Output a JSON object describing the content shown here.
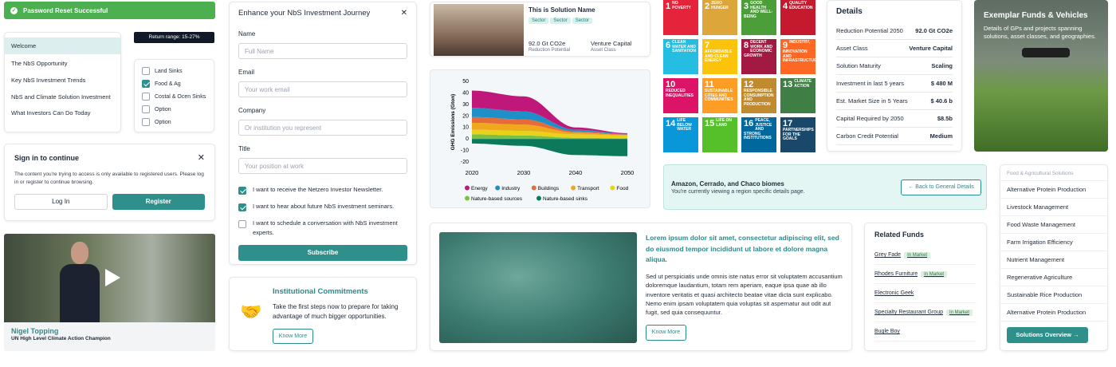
{
  "toast": {
    "text": "Password Reset Successful"
  },
  "nav": {
    "items": [
      "Welcome",
      "The NbS Opportunity",
      "Key NbS Investment Trends",
      "NbS and Climate Solution Investment",
      "What Investors Can Do Today"
    ]
  },
  "filter": {
    "tooltip": "Return range: 15-27%",
    "options": [
      {
        "label": "Land Sinks",
        "checked": false
      },
      {
        "label": "Food & Ag",
        "checked": true
      },
      {
        "label": "Costal & Ocen Sinks",
        "checked": false
      },
      {
        "label": "Option",
        "checked": false
      },
      {
        "label": "Option",
        "checked": false
      }
    ]
  },
  "signin": {
    "title": "Sign in to continue",
    "body": "The content you're trying to access is only available to registered users. Please log in or register to continue browsing.",
    "login": "Log In",
    "register": "Register"
  },
  "video": {
    "name": "Nigel Topping",
    "role": "UN High Level Climate Action Champion"
  },
  "form": {
    "title": "Enhance your NbS Investment Journey",
    "fields": [
      {
        "label": "Name",
        "placeholder": "Full Name"
      },
      {
        "label": "Email",
        "placeholder": "Your work email"
      },
      {
        "label": "Company",
        "placeholder": "Or institution you represent"
      },
      {
        "label": "Title",
        "placeholder": "Your position at work"
      }
    ],
    "checks": [
      {
        "label": "I want to receive the Netzero Investor Newsletter.",
        "checked": true
      },
      {
        "label": "I want to hear about future NbS investment seminars.",
        "checked": true
      },
      {
        "label": "I want to schedule a conversation with NbS investment experts.",
        "checked": false
      }
    ],
    "submit": "Subscribe"
  },
  "commit": {
    "title": "Institutional Commitments",
    "body": "Take the first steps now to prepare for taking advantage of much bigger opportunities.",
    "button": "Know More"
  },
  "solution": {
    "name": "This is Solution Name",
    "tags": [
      "Sector",
      "Sector",
      "Sector"
    ],
    "metric1": "92.0 Gt CO2e",
    "metric1_label": "Reduction Potential",
    "metric2": "Venture Capital",
    "metric2_label": "Asset Class"
  },
  "chart_data": {
    "type": "area",
    "ylabel": "GHG Emissions (Gton)",
    "x": [
      2020,
      2030,
      2040,
      2050
    ],
    "xticks": [
      "2020",
      "2030",
      "2040",
      "2050"
    ],
    "yticks": [
      "50",
      "40",
      "30",
      "20",
      "10",
      "0",
      "-10",
      "-20"
    ],
    "ylim": [
      -20,
      50
    ],
    "series": [
      {
        "name": "Energy",
        "color": "#c0187a",
        "values": [
          15,
          13,
          2,
          0.5
        ]
      },
      {
        "name": "Industry",
        "color": "#1f8fc8",
        "values": [
          8,
          7,
          1.5,
          0.5
        ]
      },
      {
        "name": "Buildings",
        "color": "#e86a36",
        "values": [
          5,
          4.5,
          1,
          0.5
        ]
      },
      {
        "name": "Transport",
        "color": "#f0a81c",
        "values": [
          6,
          5.5,
          1.5,
          0.5
        ]
      },
      {
        "name": "Food",
        "color": "#e8d21a",
        "values": [
          4,
          4,
          3,
          2.5
        ]
      },
      {
        "name": "Nature-based sources",
        "color": "#7cc242",
        "values": [
          4,
          3,
          1,
          0.5
        ]
      },
      {
        "name": "Nature-based sinks",
        "color": "#0c7a5a",
        "values": [
          -4,
          -6,
          -14,
          -15
        ]
      }
    ]
  },
  "sdgs": [
    {
      "n": "1",
      "t": "NO POVERTY",
      "c": "#e5243b"
    },
    {
      "n": "2",
      "t": "ZERO HUNGER",
      "c": "#dda63a"
    },
    {
      "n": "3",
      "t": "GOOD HEALTH AND WELL-BEING",
      "c": "#4c9f38"
    },
    {
      "n": "4",
      "t": "QUALITY EDUCATION",
      "c": "#c5192d"
    },
    {
      "n": "6",
      "t": "CLEAN WATER AND SANITATION",
      "c": "#26bde2"
    },
    {
      "n": "7",
      "t": "AFFORDABLE AND CLEAN ENERGY",
      "c": "#fcc30b"
    },
    {
      "n": "8",
      "t": "DECENT WORK AND ECONOMIC GROWTH",
      "c": "#a21942"
    },
    {
      "n": "9",
      "t": "INDUSTRY, INNOVATION AND INFRASTRUCTURE",
      "c": "#fd6925"
    },
    {
      "n": "10",
      "t": "REDUCED INEQUALITIES",
      "c": "#dd1367"
    },
    {
      "n": "11",
      "t": "SUSTAINABLE CITIES AND COMMUNITIES",
      "c": "#fd9d24"
    },
    {
      "n": "12",
      "t": "RESPONSIBLE CONSUMPTION AND PRODUCTION",
      "c": "#bf8b2e"
    },
    {
      "n": "13",
      "t": "CLIMATE ACTION",
      "c": "#3f7e44"
    },
    {
      "n": "14",
      "t": "LIFE BELOW WATER",
      "c": "#0a97d9"
    },
    {
      "n": "15",
      "t": "LIFE ON LAND",
      "c": "#56c02b"
    },
    {
      "n": "16",
      "t": "PEACE, JUSTICE AND STRONG INSTITUTIONS",
      "c": "#00689d"
    },
    {
      "n": "17",
      "t": "PARTNERSHIPS FOR THE GOALS",
      "c": "#19486a"
    }
  ],
  "details": {
    "title": "Details",
    "rows": [
      [
        "Reduction Potential 2050",
        "92.0 Gt CO2e"
      ],
      [
        "Asset Class",
        "Venture Capital"
      ],
      [
        "Solution Maturity",
        "Scaling"
      ],
      [
        "Investment in last 5 years",
        "$ 480 M"
      ],
      [
        "Est. Market Size in 5 Years",
        "$ 40.6 b"
      ],
      [
        "Capital Required by 2050",
        "$8.5b"
      ],
      [
        "Carbon Credit Potential",
        "Medium"
      ]
    ]
  },
  "exemplar": {
    "title": "Exemplar Funds & Vehicles",
    "body": "Details of GPs and projects spanning solutions, asset classes, and geographies."
  },
  "region": {
    "title": "Amazon, Cerrado, and Chaco biomes",
    "body": "You're currently viewing a region specific details page.",
    "button": "Back to General Details"
  },
  "article": {
    "title": "Lorem ipsum dolor sit amet, consectetur adipiscing elit, sed do eiusmod tempor incididunt ut labore et dolore magna aliqua.",
    "body": "Sed ut perspiciatis unde omnis iste natus error sit voluptatem accusantium doloremque laudantium, totam rem aperiam, eaque ipsa quae ab illo inventore veritatis et quasi architecto beatae vitae dicta sunt explicabo. Nemo enim ipsam voluptatem quia voluptas sit aspernatur aut odit aut fugit, sed quia consequuntur.",
    "button": "Know More"
  },
  "funds": {
    "title": "Related Funds",
    "items": [
      {
        "name": "Grey Fade",
        "badge": "In Market"
      },
      {
        "name": "Rhodes Furniture",
        "badge": "In Market"
      },
      {
        "name": "Electronic Geek",
        "badge": ""
      },
      {
        "name": "Specialty Restaurant Group",
        "badge": "In Market"
      },
      {
        "name": "Bugle Boy",
        "badge": ""
      }
    ]
  },
  "solutions": {
    "header": "Food & Agricultural Solutions",
    "items": [
      "Alternative Protein Production",
      "Livestock Management",
      "Food Waste Management",
      "Farm Irrigation Efficiency",
      "Nutrient Management",
      "Regenerative Agriculture",
      "Sustainable Rice Production",
      "Alternative Protein Production"
    ],
    "button": "Solutions Overview"
  }
}
